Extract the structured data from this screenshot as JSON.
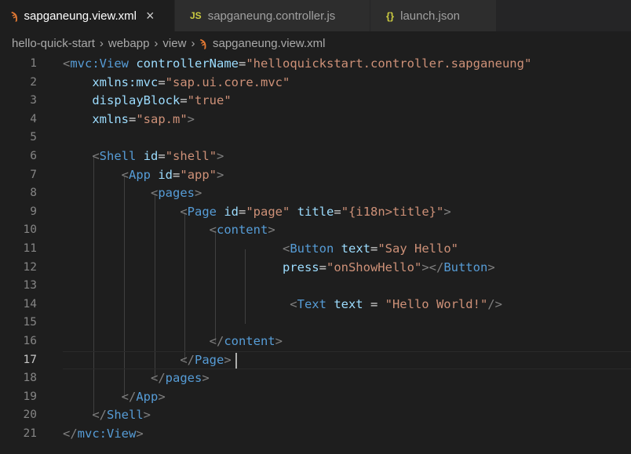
{
  "tabs": [
    {
      "label": "sapganeung.view.xml",
      "icon": "rss-icon",
      "active": true,
      "close": "×"
    },
    {
      "label": "sapganeung.controller.js",
      "icon": "js-icon",
      "icon_text": "JS"
    },
    {
      "label": "launch.json",
      "icon": "json-braces-icon",
      "icon_text": "{}"
    }
  ],
  "breadcrumb": [
    "hello-quick-start",
    "webapp",
    "view",
    "sapganeung.view.xml"
  ],
  "breadcrumb_sep": "›",
  "rss_glyph": "ϡ",
  "current_line": 17,
  "line_numbers": [
    "1",
    "2",
    "3",
    "4",
    "5",
    "6",
    "7",
    "8",
    "9",
    "10",
    "11",
    "12",
    "13",
    "14",
    "15",
    "16",
    "17",
    "18",
    "19",
    "20",
    "21"
  ],
  "code": {
    "l1": {
      "open": "<",
      "tag": "mvc:View",
      "attr": "controllerName",
      "eq": "=",
      "val": "\"helloquickstart.controller.sapganeung\""
    },
    "l2": {
      "attr": "xmlns:mvc",
      "eq": "=",
      "val": "\"sap.ui.core.mvc\""
    },
    "l3": {
      "attr": "displayBlock",
      "eq": "=",
      "val": "\"true\""
    },
    "l4": {
      "attr": "xmlns",
      "eq": "=",
      "val": "\"sap.m\"",
      "close": ">"
    },
    "l6": {
      "open": "<",
      "tag": "Shell",
      "attr": "id",
      "eq": "=",
      "val": "\"shell\"",
      "close": ">"
    },
    "l7": {
      "open": "<",
      "tag": "App",
      "attr": "id",
      "eq": "=",
      "val": "\"app\"",
      "close": ">"
    },
    "l8": {
      "open": "<",
      "tag": "pages",
      "close": ">"
    },
    "l9": {
      "open": "<",
      "tag": "Page",
      "attr1": "id",
      "eq1": "=",
      "val1": "\"page\"",
      "attr2": "title",
      "eq2": "=",
      "val2": "\"{i18n>title}\"",
      "close": ">"
    },
    "l10": {
      "open": "<",
      "tag": "content",
      "close": ">"
    },
    "l11": {
      "open": "<",
      "tag": "Button",
      "attr": "text",
      "eq": "=",
      "val": "\"Say Hello\""
    },
    "l12": {
      "attr": "press",
      "eq": "=",
      "val": "\"onShowHello\"",
      "mid": "></",
      "tag": "Button",
      "close": ">"
    },
    "l14": {
      "open": "<",
      "tag": "Text",
      "attr": "text",
      "eq": " = ",
      "val": "\"Hello World!\"",
      "close": "/>"
    },
    "l16": {
      "open": "</",
      "tag": "content",
      "close": ">"
    },
    "l17": {
      "open": "</",
      "tag": "Page",
      "close": ">"
    },
    "l18": {
      "open": "</",
      "tag": "pages",
      "close": ">"
    },
    "l19": {
      "open": "</",
      "tag": "App",
      "close": ">"
    },
    "l20": {
      "open": "</",
      "tag": "Shell",
      "close": ">"
    },
    "l21": {
      "open": "</",
      "tag": "mvc:View",
      "close": ">"
    }
  },
  "colors": {
    "tag": "#569cd6",
    "attribute": "#9cdcfe",
    "string": "#ce9178",
    "punctuation": "#808080",
    "editor_bg": "#1e1e1e",
    "tab_bg": "#2d2d2d"
  }
}
